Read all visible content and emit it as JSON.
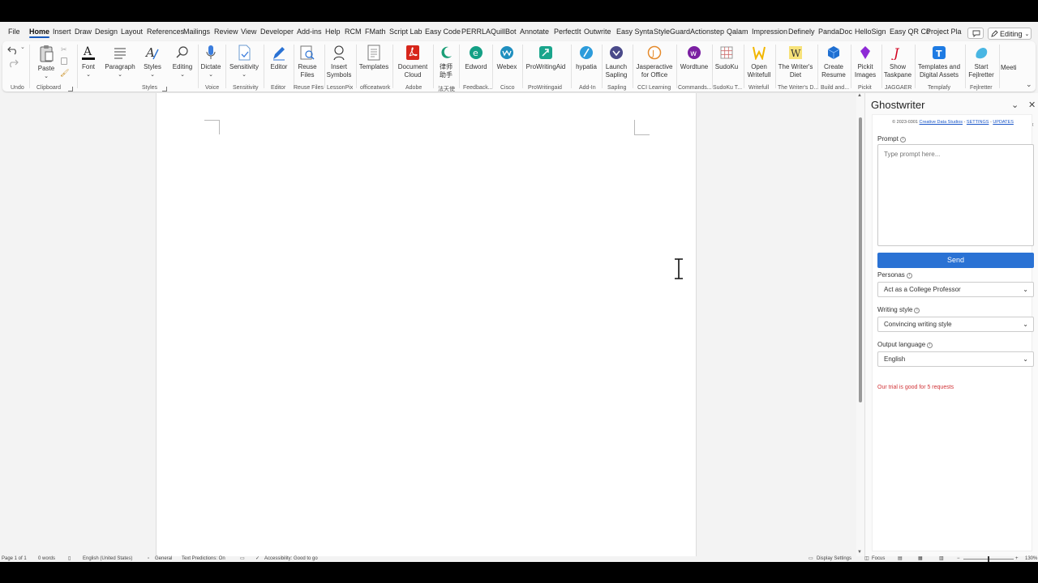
{
  "menu_tabs": [
    "File",
    "Home",
    "Insert",
    "Draw",
    "Design",
    "Layout",
    "References",
    "Mailings",
    "Review",
    "View",
    "Developer",
    "Add-ins",
    "Help",
    "RCM",
    "FMath",
    "Script Lab",
    "Easy Code",
    "PERRLA",
    "QuillBot",
    "Annotate",
    "PerfectIt",
    "Outwrite",
    "Easy Synta",
    "StyleGuard",
    "Actionstep",
    "Qalam",
    "Impression",
    "Definely",
    "PandaDoc",
    "HelloSign",
    "Easy QR Cc",
    "Project Pla"
  ],
  "active_tab": "Home",
  "editing_mode": "Editing",
  "ribbon": {
    "paste": "Paste",
    "font": "Font",
    "paragraph": "Paragraph",
    "styles": "Styles",
    "editing": "Editing",
    "dictate": "Dictate",
    "sensitivity": "Sensitivity",
    "editor": "Editor",
    "reuse_files": "Reuse Files",
    "insert_symbols": "Insert Symbols",
    "templates": "Templates",
    "document_cloud": "Document Cloud",
    "chinese_tool": "律师 助手",
    "edword": "Edword",
    "webex": "Webex",
    "prowritingaid": "ProWritingAid",
    "hypatia": "hypatia",
    "launch_sapling": "Launch Sapling",
    "jasperactive": "Jasperactive for Office",
    "wordtune": "Wordtune",
    "sudoku": "SudoKu",
    "open_writefull": "Open Writefull",
    "writers_diet": "The Writer's Diet",
    "create_resume": "Create Resume",
    "pickit_images": "Pickit Images",
    "show_taskpane": "Show Taskpane",
    "templates_assets": "Templates and Digital Assets",
    "start_fejlretter": "Start Fejlretter",
    "meeting": "Meeti"
  },
  "groups": {
    "undo": "Undo",
    "clipboard": "Clipboard",
    "styles": "Styles",
    "voice": "Voice",
    "sensitivity": "Sensitivity",
    "editor": "Editor",
    "reuse_files": "Reuse Files",
    "lessonpix": "LessonPix",
    "officeatwork": "officeatwork",
    "adobe": "Adobe",
    "chinese_group": "法天使",
    "feedback": "Feedback...",
    "cisco": "Cisco",
    "prowritingaid": "ProWritingaid",
    "addin": "Add-In",
    "sapling": "Sapling",
    "cci": "CCI Learning",
    "commands": "Commands...",
    "sudoku": "SudoKu T...",
    "writefull": "Writefull",
    "writers_d": "The Writer's D...",
    "build": "Build and...",
    "pickit": "Pickit",
    "jaggaer": "JAGGAER",
    "templafy": "Templafy",
    "fejlretter": "Fejlretter"
  },
  "pane": {
    "title": "Ghostwriter",
    "copyright_prefix": "© 2023-0301",
    "company": "Creative Data Studios",
    "settings": "SETTINGS",
    "updates": "UPDATES",
    "prompt_label": "Prompt",
    "prompt_placeholder": "Type prompt here...",
    "send": "Send",
    "personas_label": "Personas",
    "persona_value": "Act as a College Professor",
    "writing_style_label": "Writing style",
    "writing_style_value": "Convincing writing style",
    "output_language_label": "Output language",
    "output_language_value": "English",
    "trial_notice": "Our trial is good for 5 requests"
  },
  "status": {
    "page": "Page 1 of 1",
    "words": "0 words",
    "language": "English (United States)",
    "general": "General",
    "predictions": "Text Predictions: On",
    "accessibility": "Accessibility: Good to go",
    "display_settings": "Display Settings",
    "focus": "Focus",
    "zoom": "130%"
  },
  "colors": {
    "accent": "#2a72d4",
    "trial": "#d13438",
    "link": "#1a56c8"
  }
}
